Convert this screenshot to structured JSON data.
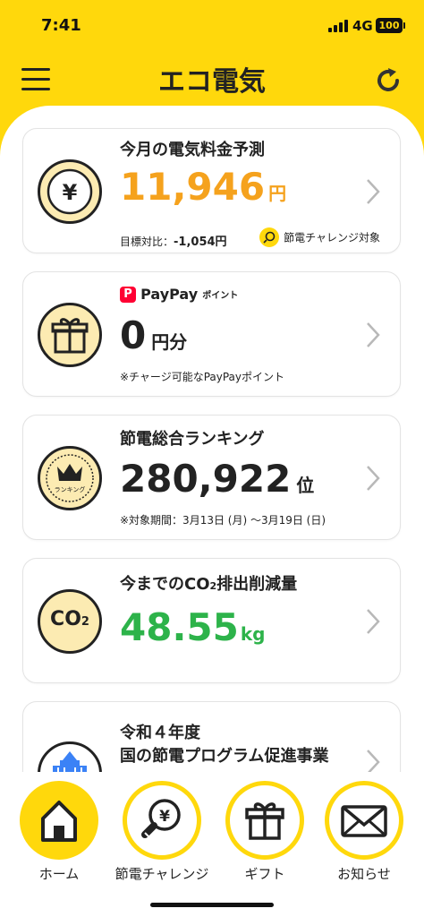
{
  "status": {
    "time": "7:41",
    "network": "4G",
    "battery": "100"
  },
  "header": {
    "title": "エコ電気",
    "menu_icon": "hamburger-menu-icon",
    "refresh_icon": "refresh-icon"
  },
  "colors": {
    "brand_yellow": "#FFD80C",
    "price_orange": "#F5A21D",
    "co2_green": "#2DB34A",
    "paypay_red": "#FF0033"
  },
  "bill_card": {
    "title": "今月の電気料金予測",
    "amount": "11,946",
    "unit": "円",
    "target_label": "目標対比：",
    "target_value": "-1,054円",
    "challenge_label": "節電チャレンジ対象",
    "icon": "yen-coin-icon"
  },
  "paypay_card": {
    "logo_text": "PayPay",
    "logo_suffix": "ポイント",
    "amount": "0",
    "unit": "円分",
    "note": "※チャージ可能なPayPayポイント",
    "icon": "gift-icon"
  },
  "ranking_card": {
    "title": "節電総合ランキング",
    "rank": "280,922",
    "unit": "位",
    "period": "※対象期間：3月13日 (月) 〜3月19日 (日)",
    "badge_text": "ランキング",
    "icon": "crown-icon"
  },
  "co2_card": {
    "title_prefix": "今までのCO",
    "title_sub": "2",
    "title_suffix": "排出削減量",
    "amount": "48.55",
    "unit": "kg",
    "icon_text": "CO",
    "icon_sub": "2"
  },
  "program_card": {
    "title_line1": "令和４年度",
    "title_line2": "国の節電プログラム促進事業",
    "icon": "government-building-icon"
  },
  "nav": [
    {
      "label": "ホーム",
      "icon": "home-icon",
      "active": true
    },
    {
      "label": "節電チャレンジ",
      "icon": "lightbulb-yen-icon",
      "active": false
    },
    {
      "label": "ギフト",
      "icon": "gift-icon",
      "active": false
    },
    {
      "label": "お知らせ",
      "icon": "envelope-icon",
      "active": false
    }
  ]
}
